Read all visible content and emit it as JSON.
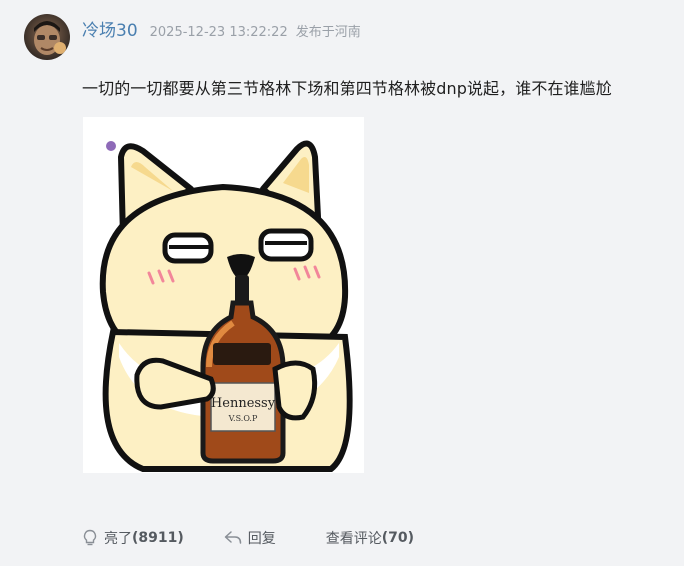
{
  "post": {
    "username": "冷场30",
    "timestamp": "2025-12-23 13:22:22",
    "location": "发布于河南",
    "content": "一切的一切都要从第三节格林下场和第四节格林被dnp说起，谁不在谁尴尬",
    "image_label": "Hennessy",
    "image_sub": "V.S.O.P"
  },
  "actions": {
    "like_label": "亮了",
    "like_count": "(8911)",
    "reply_label": "回复",
    "comments_label": "查看评论",
    "comments_count": "(70)"
  },
  "icons": {
    "like": "lightbulb-icon",
    "reply": "reply-arrow-icon"
  },
  "colors": {
    "username": "#4a7fb0",
    "meta": "#9aa0a8",
    "background": "#f2f3f5"
  }
}
